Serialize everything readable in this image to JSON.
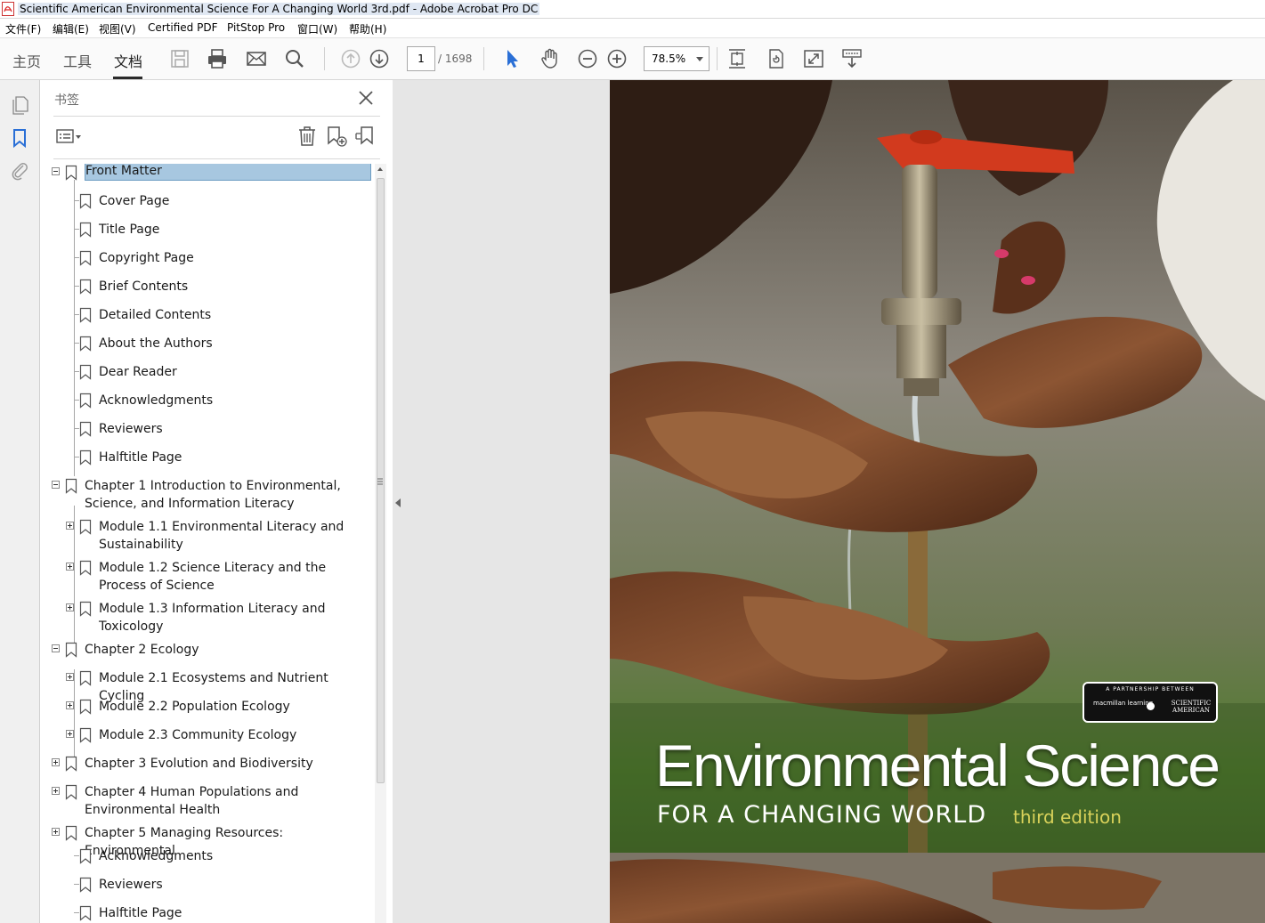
{
  "window": {
    "title": "Scientific American Environmental Science For A Changing World 3rd.pdf - Adobe Acrobat Pro DC"
  },
  "menu": [
    "文件(F)",
    "编辑(E)",
    "视图(V)",
    "Certified PDF",
    "PitStop Pro",
    "窗口(W)",
    "帮助(H)"
  ],
  "tabs": [
    "主页",
    "工具",
    "文档"
  ],
  "toolbar": {
    "current_page": "1",
    "total_pages": "/ 1698",
    "zoom": "78.5%"
  },
  "bookmarks_panel": {
    "title": "书签",
    "items": [
      {
        "label": "Front Matter",
        "level": 0,
        "expander": "minus",
        "selected": true
      },
      {
        "label": "Cover Page",
        "level": 1
      },
      {
        "label": "Title Page",
        "level": 1
      },
      {
        "label": "Copyright Page",
        "level": 1
      },
      {
        "label": "Brief Contents",
        "level": 1
      },
      {
        "label": "Detailed Contents",
        "level": 1
      },
      {
        "label": "About the Authors",
        "level": 1
      },
      {
        "label": "Dear Reader",
        "level": 1
      },
      {
        "label": "Acknowledgments",
        "level": 1
      },
      {
        "label": "Reviewers",
        "level": 1
      },
      {
        "label": "Halftitle Page",
        "level": 1
      },
      {
        "label": "Chapter 1 Introduction to Environmental, Science, and Information Literacy",
        "level": 0,
        "expander": "minus"
      },
      {
        "label": "Module 1.1 Environmental Literacy and Sustainability",
        "level": 1,
        "expander": "plus"
      },
      {
        "label": "Module 1.2 Science Literacy and the Process of Science",
        "level": 1,
        "expander": "plus"
      },
      {
        "label": "Module 1.3 Information Literacy and Toxicology",
        "level": 1,
        "expander": "plus"
      },
      {
        "label": "Chapter 2 Ecology",
        "level": 0,
        "expander": "minus"
      },
      {
        "label": "Module 2.1 Ecosystems and Nutrient Cycling",
        "level": 1,
        "expander": "plus"
      },
      {
        "label": "Module 2.2 Population Ecology",
        "level": 1,
        "expander": "plus"
      },
      {
        "label": "Module 2.3 Community Ecology",
        "level": 1,
        "expander": "plus"
      },
      {
        "label": "Chapter 3 Evolution and Biodiversity",
        "level": 0,
        "expander": "plus"
      },
      {
        "label": "Chapter 4 Human Populations and Environmental Health",
        "level": 0,
        "expander": "plus"
      },
      {
        "label": "Chapter 5 Managing Resources: Environmental",
        "level": 0,
        "expander": "plus"
      },
      {
        "label": "Acknowledgments",
        "level": 1
      },
      {
        "label": "Reviewers",
        "level": 1
      },
      {
        "label": "Halftitle Page",
        "level": 1
      }
    ]
  },
  "cover": {
    "title": "Environmental Science",
    "subtitle": "FOR A CHANGING WORLD",
    "edition": "third edition",
    "partnership": "A PARTNERSHIP BETWEEN",
    "publisher1": "macmillan learning",
    "publisher2": "SCIENTIFIC AMERICAN",
    "colors": {
      "water_tap": "#d23a1e",
      "edition": "#d9d25a",
      "photo_bg": "#6b6f5d"
    }
  }
}
